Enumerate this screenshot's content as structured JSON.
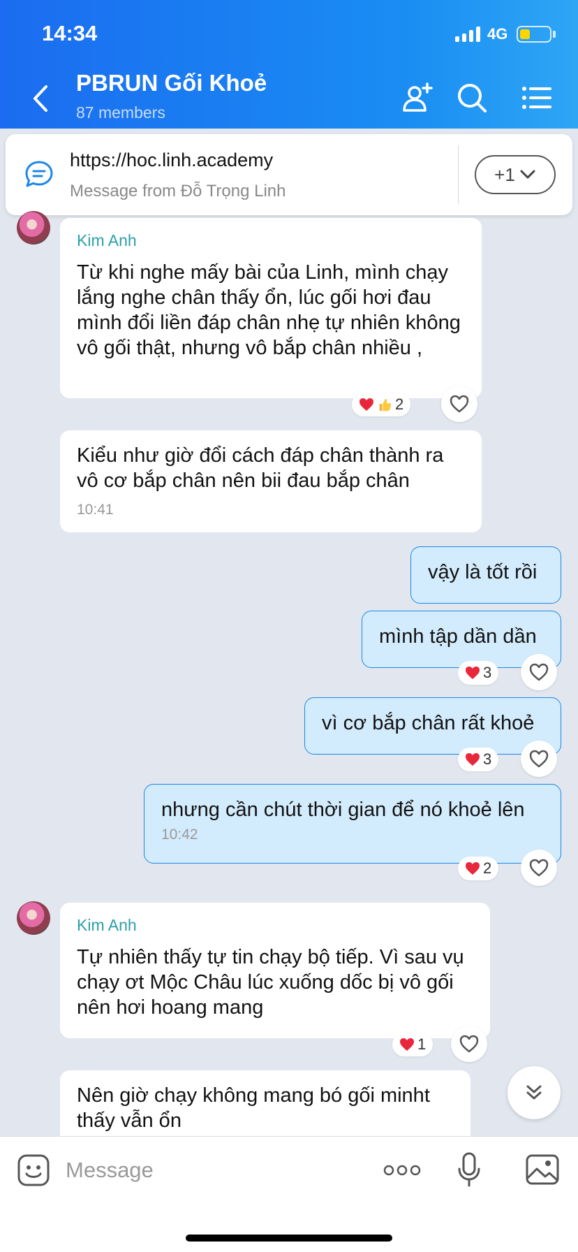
{
  "status_bar": {
    "time": "14:34",
    "network": "4G"
  },
  "header": {
    "title": "PBRUN Gối Khoẻ",
    "members": "87 members"
  },
  "pinned": {
    "link": "https://hoc.linh.academy",
    "from": "Message from Đỗ Trọng Linh",
    "more": "+1"
  },
  "messages": {
    "m1": {
      "sender": "Kim Anh",
      "text": "Từ khi nghe mấy bài của Linh, mình chạy lắng nghe chân thấy ổn, lúc gối hơi đau mình đổi liền đáp chân nhẹ tự nhiên không vô gối thật, nhưng vô bắp chân nhiều ,",
      "reaction_count": "2"
    },
    "m2": {
      "text": "Kiểu như giờ đổi cách đáp chân thành ra vô cơ bắp chân nên bii đau bắp chân",
      "time": "10:41"
    },
    "m3": {
      "text": "vậy là tốt rồi"
    },
    "m4": {
      "text": "mình tập dần dần",
      "reaction_count": "3"
    },
    "m5": {
      "text": "vì cơ bắp chân rất khoẻ",
      "reaction_count": "3"
    },
    "m6": {
      "text": "nhưng cần chút thời gian để nó khoẻ lên",
      "time": "10:42",
      "reaction_count": "2"
    },
    "m7": {
      "sender": "Kim Anh",
      "text": "Tự nhiên thấy tự tin chạy bộ tiếp. Vì sau vụ chạy ơt Mộc Châu lúc xuống dốc bị vô gối nên hơi hoang mang",
      "reaction_count": "1"
    },
    "m8": {
      "text": "Nên giờ chạy không mang bó gối minht thấy vẫn ổn"
    }
  },
  "input": {
    "placeholder": "Message"
  },
  "colors": {
    "header_start": "#1b6cf0",
    "header_end": "#2ea6f5",
    "my_bubble": "#d3ecfd",
    "sender_name": "#2b9fa8"
  }
}
